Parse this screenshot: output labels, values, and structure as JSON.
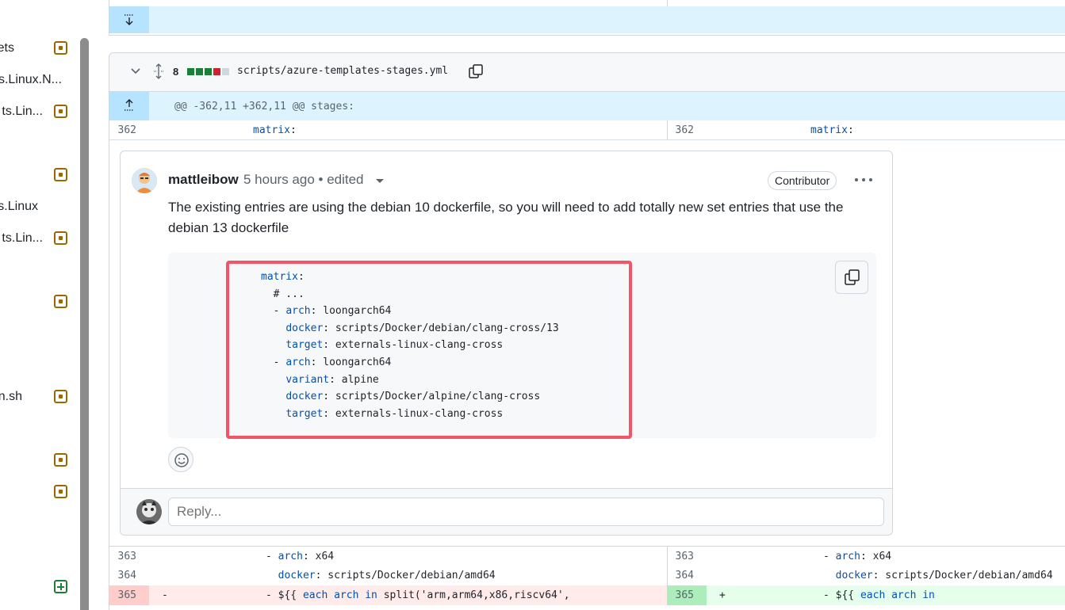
{
  "file_tree": {
    "items": [
      {
        "label": "ets",
        "badge": "modified"
      },
      {
        "label": "s.Linux.N...",
        "badge": ""
      },
      {
        "label": "ts.Lin...",
        "badge": "modified"
      },
      {
        "label": "",
        "badge": "modified"
      },
      {
        "label": "s.Linux",
        "badge": ""
      },
      {
        "label": "ts.Lin...",
        "badge": "modified"
      },
      {
        "label": "",
        "badge": "modified"
      },
      {
        "label": "n.sh",
        "badge": "modified"
      },
      {
        "label": "",
        "badge": "modified"
      },
      {
        "label": "",
        "badge": "modified"
      },
      {
        "label": "",
        "badge": "added"
      }
    ]
  },
  "file": {
    "changes_count": "8",
    "path": "scripts/azure-templates-stages.yml",
    "hunk_header": "@@ -362,11 +362,11 @@ stages:",
    "diffstat_colors": [
      "#1a7f37",
      "#1a7f37",
      "#1a7f37",
      "#cf222e",
      "#d0d7de"
    ]
  },
  "context_lines": {
    "top": {
      "left_no": "362",
      "left_key": "matrix",
      "left_rest": ":",
      "right_no": "362",
      "right_key": "matrix",
      "right_rest": ":"
    },
    "after": [
      {
        "left_no": "363",
        "left_prefix": "- ",
        "left_key": "arch",
        "left_rest": ": x64",
        "right_no": "363",
        "right_prefix": "- ",
        "right_key": "arch",
        "right_rest": ": x64"
      },
      {
        "left_no": "364",
        "left_prefix": "  ",
        "left_key": "docker",
        "left_rest": ": scripts/Docker/debian/amd64",
        "right_no": "364",
        "right_prefix": "  ",
        "right_key": "docker",
        "right_rest": ": scripts/Docker/debian/amd64"
      }
    ],
    "changed": {
      "left_no": "365",
      "left_marker": "-",
      "left_text": "- ${{ each arch in split('arm,arm64,x86,riscv64',",
      "right_no": "365",
      "right_marker": "+",
      "right_text": "- ${{ each arch in"
    }
  },
  "comment": {
    "author": "mattleibow",
    "meta": "5 hours ago • edited",
    "badge": "Contributor",
    "body": "The existing entries are using the debian 10 dockerfile, so you will need to add totally new set entries that use the debian 13 dockerfile",
    "code_lines": [
      {
        "indent": "",
        "key": "matrix",
        "rest": ":"
      },
      {
        "indent": "  ",
        "key": "",
        "rest": "# ..."
      },
      {
        "indent": "  - ",
        "key": "arch",
        "rest": ": loongarch64"
      },
      {
        "indent": "    ",
        "key": "docker",
        "rest": ": scripts/Docker/debian/clang-cross/13"
      },
      {
        "indent": "    ",
        "key": "target",
        "rest": ": externals-linux-clang-cross"
      },
      {
        "indent": "  - ",
        "key": "arch",
        "rest": ": loongarch64"
      },
      {
        "indent": "    ",
        "key": "variant",
        "rest": ": alpine"
      },
      {
        "indent": "    ",
        "key": "docker",
        "rest": ": scripts/Docker/alpine/clang-cross"
      },
      {
        "indent": "    ",
        "key": "target",
        "rest": ": externals-linux-clang-cross"
      }
    ],
    "reply_placeholder": "Reply...",
    "highlight_color": "#f25565"
  },
  "icons": {
    "chevron": "chevron-down-icon",
    "expand": "unfold-icon",
    "copy": "copy-icon",
    "emoji": "smiley-icon",
    "kebab": "kebab-horizontal-icon"
  }
}
